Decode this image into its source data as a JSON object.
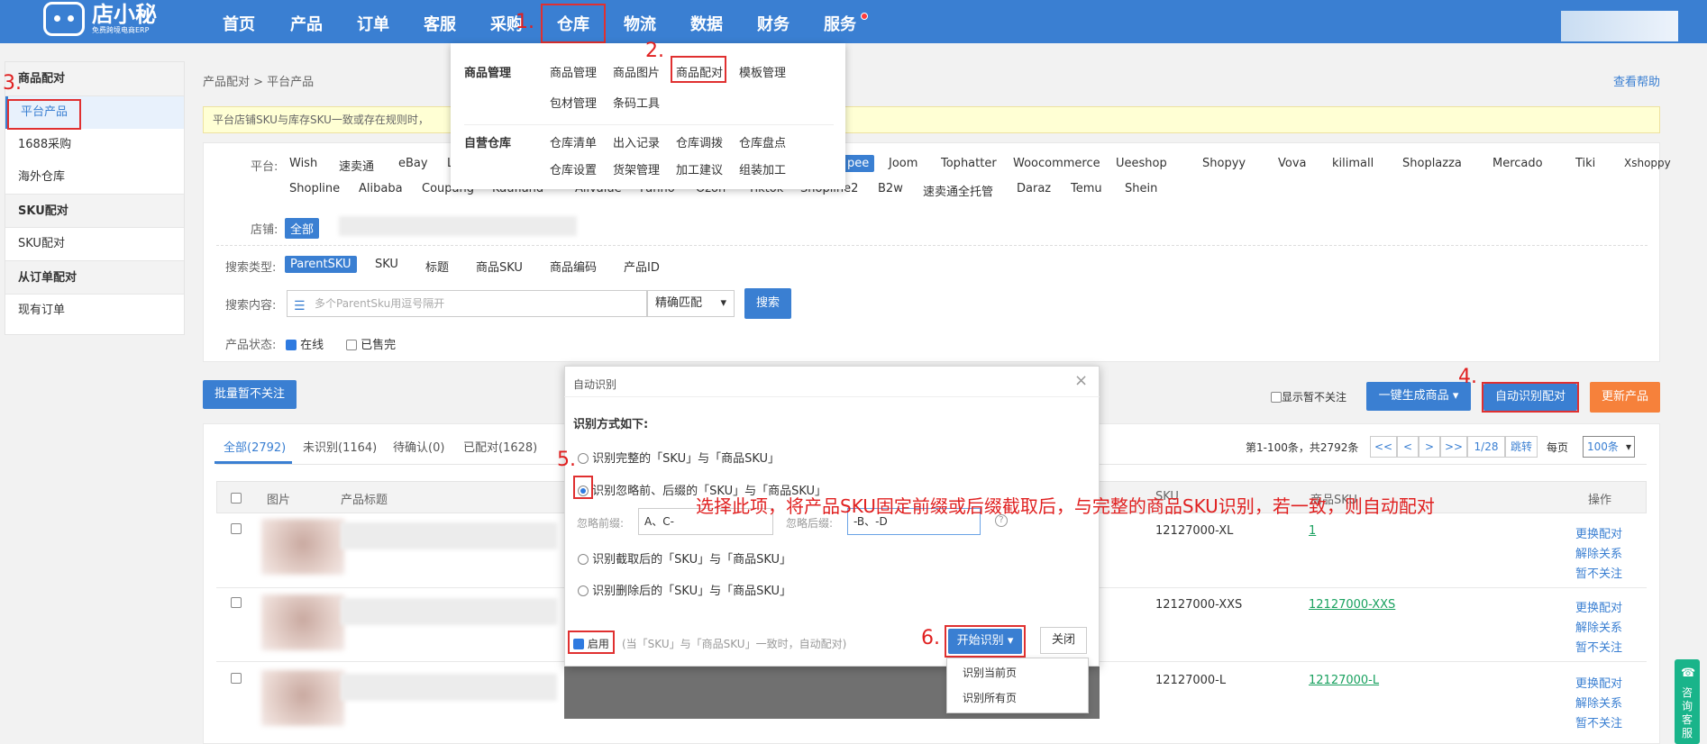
{
  "app": {
    "logo_name": "店小秘",
    "logo_sub": "免费跨境电商ERP"
  },
  "nav": {
    "items": [
      "首页",
      "产品",
      "订单",
      "客服",
      "采购",
      "仓库",
      "物流",
      "数据",
      "财务",
      "服务"
    ]
  },
  "annotations": {
    "n1": "1.",
    "n2": "2.",
    "n3": "3.",
    "n4": "4.",
    "n5": "5.",
    "n6": "6.",
    "hint": "选择此项，将产品SKU固定前缀或后缀截取后，与完整的商品SKU识别，若一致，则自动配对"
  },
  "sidebar": {
    "sections": [
      {
        "title": "商品配对",
        "items": [
          "平台产品",
          "1688采购",
          "海外仓库"
        ]
      },
      {
        "title": "SKU配对",
        "items": [
          "SKU配对"
        ]
      },
      {
        "title": "从订单配对",
        "items": [
          "现有订单"
        ]
      }
    ]
  },
  "breadcrumb": "产品配对 > 平台产品",
  "help": "查看帮助",
  "notice": "平台店铺SKU与库存SKU一致或存在规则时，",
  "filters": {
    "platform_label": "平台:",
    "platforms_row1": [
      "Wish",
      "速卖通",
      "eBay",
      "L"
    ],
    "platforms_row1_right": [
      "Joom",
      "Tophatter",
      "Woocommerce",
      "Ueeshop",
      "Shopyy",
      "Vova",
      "kilimall",
      "Shoplazza",
      "Mercado",
      "Tiki",
      "Xshoppy"
    ],
    "platform_active_partial": "pee",
    "platforms_row2": [
      "Shopline",
      "Alibaba",
      "Coupang",
      "Kaufland",
      "Allvalue",
      "Fanno",
      "Ozon",
      "Tiktok",
      "Shopline2",
      "B2w",
      "速卖通全托管",
      "Daraz",
      "Temu",
      "Shein"
    ],
    "store_label": "店铺:",
    "store_all": "全部",
    "search_type_label": "搜索类型:",
    "search_types": [
      "ParentSKU",
      "SKU",
      "标题",
      "商品SKU",
      "商品编码",
      "产品ID"
    ],
    "search_content_label": "搜索内容:",
    "search_placeholder": "多个ParentSku用逗号隔开",
    "match_mode": "精确匹配",
    "search_btn": "搜索",
    "status_label": "产品状态:",
    "status_online": "在线",
    "status_soldout": "已售完"
  },
  "toolbar": {
    "batch_ignore": "批量暂不关注",
    "show_ignored": "显示暂不关注",
    "gen_goods": "一键生成商品",
    "auto_match": "自动识别配对",
    "update": "更新产品"
  },
  "tabs": [
    {
      "label": "全部(2792)"
    },
    {
      "label": "未识别(1164)"
    },
    {
      "label": "待确认(0)"
    },
    {
      "label": "已配对(1628)"
    }
  ],
  "pager": {
    "info": "第1-100条，共2792条",
    "first": "<<",
    "prev": "<",
    "next": ">",
    "last": ">>",
    "page": "1/28",
    "jump": "跳转",
    "per_label": "每页",
    "per_value": "100条"
  },
  "table": {
    "headers": {
      "img": "图片",
      "title": "产品标题",
      "sku": "SKU",
      "goods_sku": "商品SKU",
      "op": "操作"
    },
    "rows": [
      {
        "sku": "12127000-XL",
        "goods_sku": "1"
      },
      {
        "sku": "12127000-XXS",
        "goods_sku": "12127000-XXS"
      },
      {
        "sku": "12127000-L",
        "goods_sku": "12127000-L"
      }
    ],
    "ops": [
      "更换配对",
      "解除关系",
      "暂不关注"
    ]
  },
  "dropdown": {
    "group1_title": "商品管理",
    "group1_row1": [
      "商品管理",
      "商品图片",
      "商品配对",
      "模板管理"
    ],
    "group1_row2": [
      "包材管理",
      "条码工具"
    ],
    "group2_title": "自营仓库",
    "group2_row1": [
      "仓库清单",
      "出入记录",
      "仓库调拨",
      "仓库盘点"
    ],
    "group2_row2": [
      "仓库设置",
      "货架管理",
      "加工建议",
      "组装加工"
    ]
  },
  "dialog": {
    "title": "自动识别",
    "close": "×",
    "method_label": "识别方式如下:",
    "options": [
      "识别完整的「SKU」与「商品SKU」",
      "识别忽略前、后缀的「SKU」与「商品SKU」",
      "识别截取后的「SKU」与「商品SKU」",
      "识别删除后的「SKU」与「商品SKU」"
    ],
    "ignore_prefix_label": "忽略前缀:",
    "ignore_prefix_value": "A、C-",
    "ignore_suffix_label": "忽略后缀:",
    "ignore_suffix_value": "-B、-D",
    "help_icon": "?",
    "enable_label": "启用",
    "enable_note": "(当「SKU」与「商品SKU」一致时，自动配对)",
    "start_btn": "开始识别",
    "close_btn": "关闭",
    "menu": [
      "识别当前页",
      "识别所有页"
    ]
  },
  "consult": "咨询客服",
  "colors": {
    "primary": "#3a7fd2",
    "annotation": "#e02020",
    "orange": "#f6813b"
  }
}
